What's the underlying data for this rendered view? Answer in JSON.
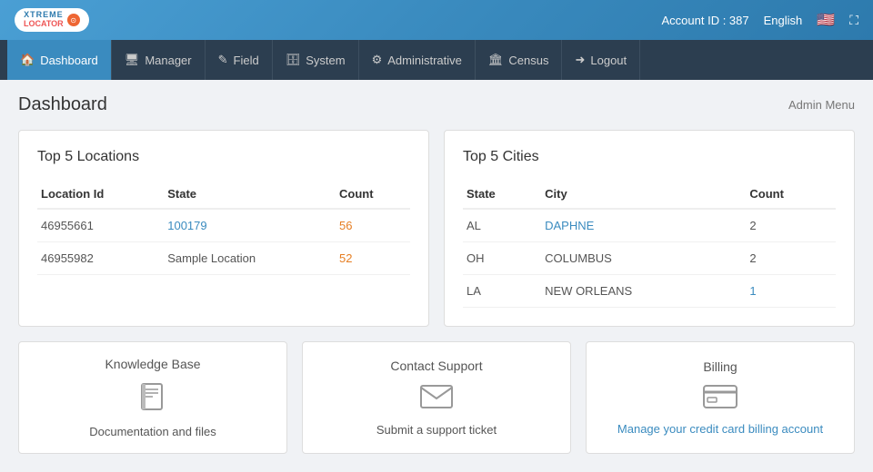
{
  "header": {
    "account_id_label": "Account ID : 387",
    "language_label": "English",
    "logo_top": "XTREME",
    "logo_bottom": "LOCATOR"
  },
  "nav": {
    "items": [
      {
        "label": "Dashboard",
        "icon": "🏠",
        "active": true
      },
      {
        "label": "Manager",
        "icon": "🖥"
      },
      {
        "label": "Field",
        "icon": "✎"
      },
      {
        "label": "System",
        "icon": "🗄"
      },
      {
        "label": "Administrative",
        "icon": "⚙"
      },
      {
        "label": "Census",
        "icon": "🏛"
      },
      {
        "label": "Logout",
        "icon": "➜"
      }
    ]
  },
  "page": {
    "title": "Dashboard",
    "admin_menu": "Admin Menu"
  },
  "top5locations": {
    "title": "Top 5 Locations",
    "columns": [
      "Location Id",
      "State",
      "Count"
    ],
    "rows": [
      {
        "id": "46955661",
        "state": "100179",
        "count": "56"
      },
      {
        "id": "46955982",
        "state": "Sample Location",
        "count": "52"
      }
    ]
  },
  "top5cities": {
    "title": "Top 5 Cities",
    "columns": [
      "State",
      "City",
      "Count"
    ],
    "rows": [
      {
        "state": "AL",
        "city": "DAPHNE",
        "count": "2"
      },
      {
        "state": "OH",
        "city": "COLUMBUS",
        "count": "2"
      },
      {
        "state": "LA",
        "city": "NEW ORLEANS",
        "count": "1"
      }
    ]
  },
  "bottom_cards": [
    {
      "title": "Knowledge Base",
      "icon_type": "book",
      "description": "Documentation and files",
      "is_link": false,
      "link_text": ""
    },
    {
      "title": "Contact Support",
      "icon_type": "envelope",
      "description": "Submit a support ticket",
      "is_link": false,
      "link_text": ""
    },
    {
      "title": "Billing",
      "icon_type": "credit-card",
      "description": "Manage your credit card billing account",
      "is_link": true,
      "link_text": "Manage your credit card billing account"
    }
  ]
}
